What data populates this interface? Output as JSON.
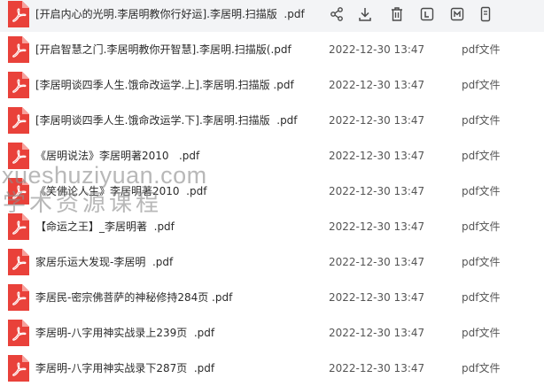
{
  "files": [
    {
      "name": "[开启内心的光明.李居明教你行好运].李居明.扫描版  .pdf",
      "date": "",
      "type": ""
    },
    {
      "name": "[开启智慧之门.李居明教你开智慧].李居明.扫描版(.pdf",
      "date": "2022-12-30 13:47",
      "type": "pdf文件"
    },
    {
      "name": "[李居明谈四季人生.饿命改运学.上].李居明.扫描版 .pdf",
      "date": "2022-12-30 13:47",
      "type": "pdf文件"
    },
    {
      "name": "[李居明谈四季人生.饿命改运学.下].李居明.扫描版  .pdf",
      "date": "2022-12-30 13:47",
      "type": "pdf文件"
    },
    {
      "name": "《居明说法》李居明著2010   .pdf",
      "date": "2022-12-30 13:47",
      "type": "pdf文件"
    },
    {
      "name": "《笑佛论人生》李居明著2010  .pdf",
      "date": "2022-12-30 13:47",
      "type": "pdf文件"
    },
    {
      "name": "【命运之王】_李居明著  .pdf",
      "date": "2022-12-30 13:47",
      "type": "pdf文件"
    },
    {
      "name": "家居乐运大发现-李居明  .pdf",
      "date": "2022-12-30 13:47",
      "type": "pdf文件"
    },
    {
      "name": "李居民-密宗佛菩萨的神秘修持284页 .pdf",
      "date": "2022-12-30 13:47",
      "type": "pdf文件"
    },
    {
      "name": "李居明-八字用神实战录上239页  .pdf",
      "date": "2022-12-30 13:47",
      "type": "pdf文件"
    },
    {
      "name": "李居明-八字用神实战录下287页  .pdf",
      "date": "2022-12-30 13:47",
      "type": "pdf文件"
    }
  ],
  "row_actions": [
    "share-icon",
    "download-icon",
    "delete-icon",
    "copy-link-icon",
    "open-panel-icon",
    "more-icon"
  ],
  "colors": {
    "pdf_red": "#e9413a",
    "hover_background": "#f3f4f6",
    "action_icon": "#4a4a4a",
    "watermark": "#8c8c8c"
  },
  "watermark": {
    "line1": "xueshuziyuan.com",
    "line2": "学术资源课程"
  }
}
